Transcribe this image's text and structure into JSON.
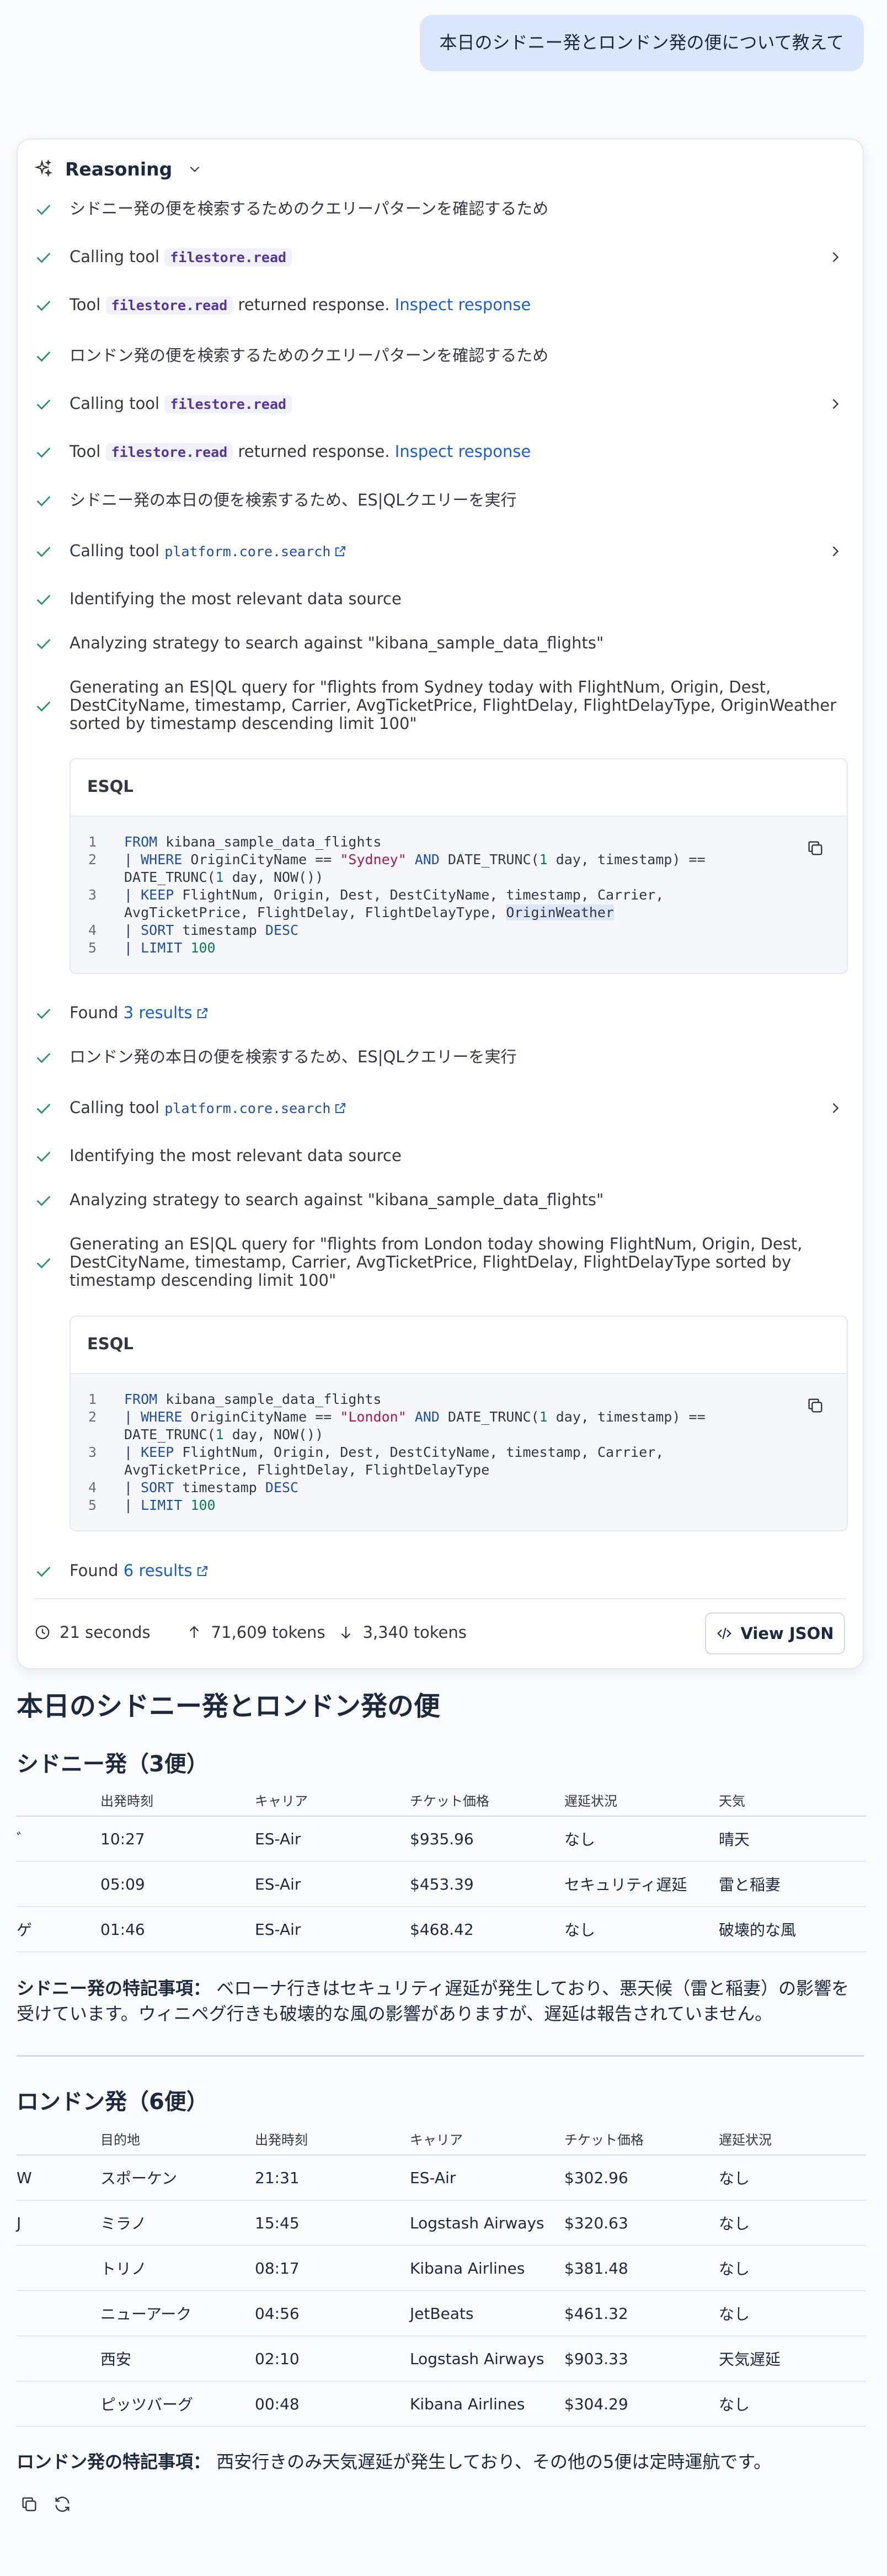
{
  "user_message": "本日のシドニー発とロンドン発の便について教えて",
  "reasoning": {
    "title": "Reasoning",
    "steps": [
      {
        "kind": "text",
        "text": "シドニー発の便を検索するためのクエリーパターンを確認するため"
      },
      {
        "kind": "call",
        "prefix": "Calling tool",
        "tool": "filestore.read"
      },
      {
        "kind": "resp",
        "prefix": "Tool",
        "tool": "filestore.read",
        "suffix": "returned response.",
        "link": "Inspect response"
      },
      {
        "kind": "text",
        "text": "ロンドン発の便を検索するためのクエリーパターンを確認するため"
      },
      {
        "kind": "call",
        "prefix": "Calling tool",
        "tool": "filestore.read"
      },
      {
        "kind": "resp",
        "prefix": "Tool",
        "tool": "filestore.read",
        "suffix": "returned response.",
        "link": "Inspect response"
      },
      {
        "kind": "text",
        "text": "シドニー発の本日の便を検索するため、ES|QLクエリーを実行"
      },
      {
        "kind": "call2",
        "prefix": "Calling tool",
        "tool": "platform.core.search"
      },
      {
        "kind": "text",
        "text": "Identifying the most relevant data source"
      },
      {
        "kind": "text",
        "text": "Analyzing strategy to search against \"kibana_sample_data_flights\""
      },
      {
        "kind": "text",
        "text": "Generating an ES|QL query for \"flights from Sydney today with FlightNum, Origin, Dest, DestCityName, timestamp, Carrier, AvgTicketPrice, FlightDelay, FlightDelayType, OriginWeather sorted by timestamp descending limit 100\""
      },
      {
        "kind": "found",
        "prefix": "Found",
        "link": "3 results"
      },
      {
        "kind": "text",
        "text": "ロンドン発の本日の便を検索するため、ES|QLクエリーを実行"
      },
      {
        "kind": "call2",
        "prefix": "Calling tool",
        "tool": "platform.core.search"
      },
      {
        "kind": "text",
        "text": "Identifying the most relevant data source"
      },
      {
        "kind": "text",
        "text": "Analyzing strategy to search against \"kibana_sample_data_flights\""
      },
      {
        "kind": "text",
        "text": "Generating an ES|QL query for \"flights from London today showing FlightNum, Origin, Dest, DestCityName, timestamp, Carrier, AvgTicketPrice, FlightDelay, FlightDelayType sorted by timestamp descending limit 100\""
      },
      {
        "kind": "found",
        "prefix": "Found",
        "link": "6 results"
      }
    ],
    "esql_label": "ESQL",
    "query1": {
      "line_numbers": [
        "1",
        "2",
        "3",
        "4",
        "5"
      ],
      "l1_kw": "FROM",
      "l1_rest": " kibana_sample_data_flights",
      "l2_pipe": "| ",
      "l2_kw": "WHERE",
      "l2_a": " OriginCityName == ",
      "l2_str": "\"Sydney\"",
      "l2_and": " AND ",
      "l2_b": "DATE_TRUNC(",
      "l2_n1": "1",
      "l2_c": " day, timestamp) == DATE_TRUNC(",
      "l2_n2": "1",
      "l2_d": " day, NOW())",
      "l3_pipe": "| ",
      "l3_kw": "KEEP",
      "l3_rest": " FlightNum, Origin, Dest, DestCityName, timestamp, Carrier, AvgTicketPrice, FlightDelay, FlightDelayType, ",
      "l3_hl": "OriginWeather",
      "l4_pipe": "| ",
      "l4_kw": "SORT",
      "l4_rest": " timestamp ",
      "l4_kw2": "DESC",
      "l5_pipe": "| ",
      "l5_kw": "LIMIT",
      "l5_sp": " ",
      "l5_num": "100"
    },
    "query2": {
      "line_numbers": [
        "1",
        "2",
        "3",
        "4",
        "5"
      ],
      "l1_kw": "FROM",
      "l1_rest": " kibana_sample_data_flights",
      "l2_pipe": "| ",
      "l2_kw": "WHERE",
      "l2_a": " OriginCityName == ",
      "l2_str": "\"London\"",
      "l2_and": " AND ",
      "l2_b": "DATE_TRUNC(",
      "l2_n1": "1",
      "l2_c": " day, timestamp) == DATE_TRUNC(",
      "l2_n2": "1",
      "l2_d": " day, NOW())",
      "l3_pipe": "| ",
      "l3_kw": "KEEP",
      "l3_rest": " FlightNum, Origin, Dest, DestCityName, timestamp, Carrier, AvgTicketPrice, FlightDelay, FlightDelayType",
      "l4_pipe": "| ",
      "l4_kw": "SORT",
      "l4_rest": " timestamp ",
      "l4_kw2": "DESC",
      "l5_pipe": "| ",
      "l5_kw": "LIMIT",
      "l5_sp": " ",
      "l5_num": "100"
    },
    "footer": {
      "duration": "21 seconds",
      "tokens_in": "71,609 tokens",
      "tokens_out": "3,340 tokens",
      "view_json": "View JSON"
    }
  },
  "answer": {
    "title": "本日のシドニー発とロンドン発の便",
    "sydney": {
      "heading": "シドニー発（3便）",
      "columns": [
        "出発時刻",
        "キャリア",
        "チケット価格",
        "遅延状況",
        "天気"
      ],
      "rows": [
        {
          "cut": "ﾞ",
          "c": [
            "10:27",
            "ES-Air",
            "$935.96",
            "なし",
            "晴天"
          ]
        },
        {
          "cut": "",
          "c": [
            "05:09",
            "ES-Air",
            "$453.39",
            "セキュリティ遅延",
            "雷と稲妻"
          ]
        },
        {
          "cut": "ゲ",
          "c": [
            "01:46",
            "ES-Air",
            "$468.42",
            "なし",
            "破壊的な風"
          ]
        }
      ],
      "note_label": "シドニー発の特記事項：",
      "note_text": " ベローナ行きはセキュリティ遅延が発生しており、悪天候（雷と稲妻）の影響を受けています。ウィニペグ行きも破壊的な風の影響がありますが、遅延は報告されていません。"
    },
    "london": {
      "heading": "ロンドン発（6便）",
      "columns": [
        "目的地",
        "出発時刻",
        "キャリア",
        "チケット価格",
        "遅延状況"
      ],
      "rows": [
        {
          "cut": "W",
          "c": [
            "スポーケン",
            "21:31",
            "ES-Air",
            "$302.96",
            "なし"
          ]
        },
        {
          "cut": "J",
          "c": [
            "ミラノ",
            "15:45",
            "Logstash Airways",
            "$320.63",
            "なし"
          ]
        },
        {
          "cut": "",
          "c": [
            "トリノ",
            "08:17",
            "Kibana Airlines",
            "$381.48",
            "なし"
          ]
        },
        {
          "cut": "",
          "c": [
            "ニューアーク",
            "04:56",
            "JetBeats",
            "$461.32",
            "なし"
          ]
        },
        {
          "cut": "",
          "c": [
            "西安",
            "02:10",
            "Logstash Airways",
            "$903.33",
            "天気遅延"
          ]
        },
        {
          "cut": "",
          "c": [
            "ピッツバーグ",
            "00:48",
            "Kibana Airlines",
            "$304.29",
            "なし"
          ]
        }
      ],
      "note_label": "ロンドン発の特記事項：",
      "note_text": " 西安行きのみ天気遅延が発生しており、その他の5便は定時運航です。"
    }
  },
  "icons": {
    "header": "sparkles-icon",
    "collapse": "chevron-down-icon",
    "step": "check-icon",
    "expand": "chevron-right-icon",
    "external": "external-link-icon",
    "copy": "copy-icon",
    "clock": "clock-icon",
    "up": "arrow-up-icon",
    "down": "arrow-down-icon",
    "code": "code-icon",
    "regenerate": "refresh-icon"
  },
  "colors": {
    "accent": "#1a5ec7",
    "check": "#2f8f6e",
    "chip_text": "#54359a",
    "string": "#b0174a",
    "number": "#0d7a50",
    "user_bubble": "#d9e6fb"
  }
}
